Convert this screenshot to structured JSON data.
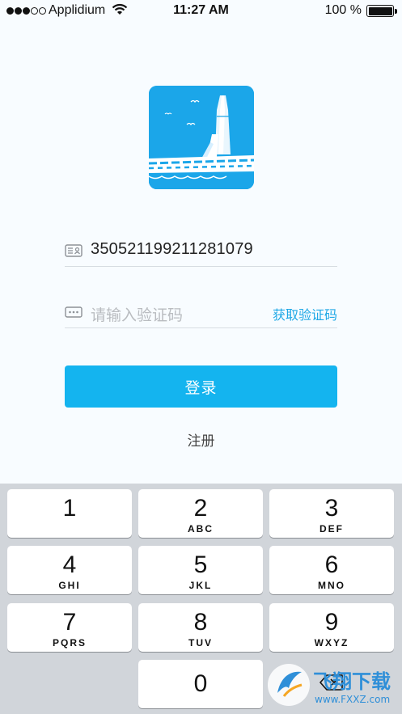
{
  "status_bar": {
    "carrier": "Applidium",
    "time": "11:27 AM",
    "battery": "100 %"
  },
  "form": {
    "id_number": "350521199211281079",
    "code_placeholder": "请输入验证码",
    "get_code_label": "获取验证码",
    "login_label": "登录",
    "register_label": "注册"
  },
  "keypad": {
    "keys": [
      {
        "num": "1",
        "letters": ""
      },
      {
        "num": "2",
        "letters": "ABC"
      },
      {
        "num": "3",
        "letters": "DEF"
      },
      {
        "num": "4",
        "letters": "GHI"
      },
      {
        "num": "5",
        "letters": "JKL"
      },
      {
        "num": "6",
        "letters": "MNO"
      },
      {
        "num": "7",
        "letters": "PQRS"
      },
      {
        "num": "8",
        "letters": "TUV"
      },
      {
        "num": "9",
        "letters": "WXYZ"
      },
      {
        "num": "0",
        "letters": ""
      }
    ]
  },
  "watermark": {
    "brand": "飞翔下载",
    "site": "www.FXXZ.com"
  },
  "colors": {
    "accent": "#14b4ef",
    "link": "#1fa8e6",
    "logo_bg": "#1ba6e9",
    "keyboard_bg": "#d1d5da"
  }
}
